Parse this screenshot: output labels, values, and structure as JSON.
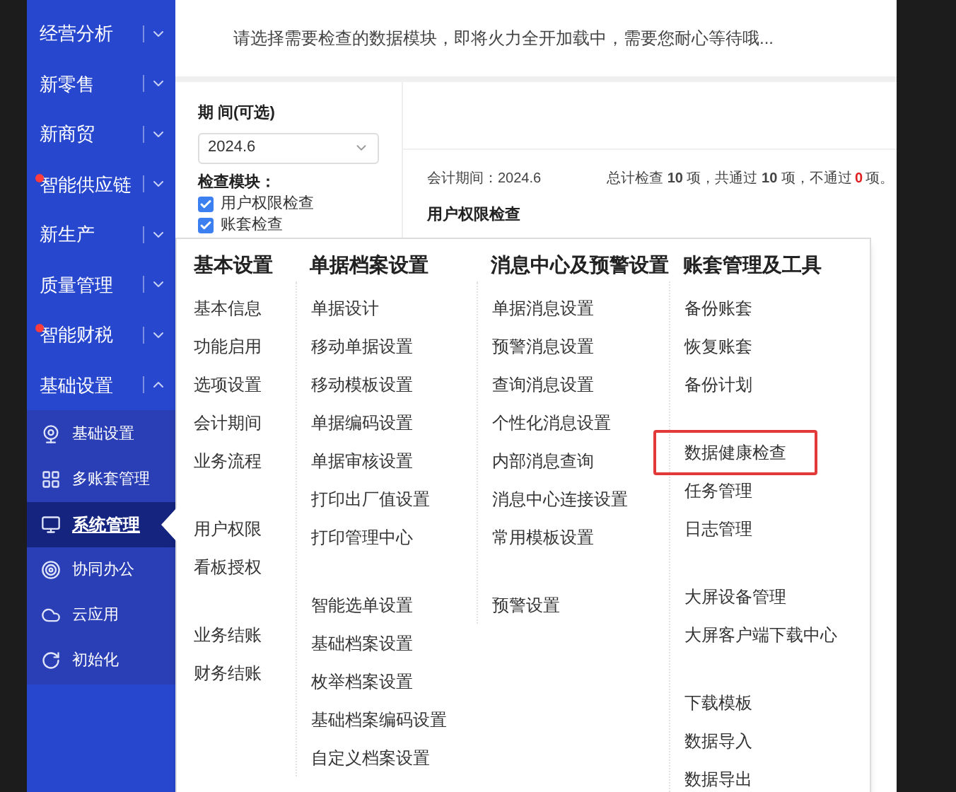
{
  "sidebar": {
    "items": [
      {
        "label": "经营分析",
        "expanded": false,
        "alert": false
      },
      {
        "label": "新零售",
        "expanded": false,
        "alert": false
      },
      {
        "label": "新商贸",
        "expanded": false,
        "alert": false
      },
      {
        "label": "智能供应链",
        "expanded": false,
        "alert": true
      },
      {
        "label": "新生产",
        "expanded": false,
        "alert": false
      },
      {
        "label": "质量管理",
        "expanded": false,
        "alert": false
      },
      {
        "label": "智能财税",
        "expanded": false,
        "alert": true
      },
      {
        "label": "基础设置",
        "expanded": true,
        "alert": false,
        "children": [
          {
            "label": "基础设置",
            "kind": "webcam",
            "selected": false
          },
          {
            "label": "多账套管理",
            "kind": "grid",
            "selected": false
          },
          {
            "label": "系统管理",
            "kind": "monitor",
            "selected": true
          },
          {
            "label": "协同办公",
            "kind": "target",
            "selected": false
          },
          {
            "label": "云应用",
            "kind": "cloud",
            "selected": false
          },
          {
            "label": "初始化",
            "kind": "refresh",
            "selected": false
          }
        ]
      }
    ]
  },
  "notice": "请选择需要检查的数据模块，即将火力全开加载中，需要您耐心等待哦...",
  "filter": {
    "period_label": "期 间(可选)",
    "period": "2024.6",
    "modules_label": "检查模块：",
    "modules": [
      {
        "label": "用户权限检查",
        "checked": true
      },
      {
        "label": "账套检查",
        "checked": true
      }
    ]
  },
  "result": {
    "period": "会计期间：2024.6",
    "summary": {
      "text": "总计检查 **10** 项，共通过 **10** 项，不通过",
      "failed": "0",
      "suffix": "项。"
    },
    "section_title": "用户权限检查"
  },
  "menu": {
    "columns": [
      {
        "title": "基本设置",
        "groups": [
          [
            {
              "label": "基本信息",
              "highlighted": false
            },
            {
              "label": "功能启用",
              "highlighted": false
            },
            {
              "label": "选项设置",
              "highlighted": false
            },
            {
              "label": "会计期间",
              "highlighted": false
            },
            {
              "label": "业务流程",
              "highlighted": false
            }
          ],
          [
            {
              "label": "用户权限",
              "highlighted": false
            },
            {
              "label": "看板授权",
              "highlighted": false
            }
          ],
          [
            {
              "label": "业务结账",
              "highlighted": false
            },
            {
              "label": "财务结账",
              "highlighted": false
            }
          ]
        ]
      },
      {
        "title": "单据档案设置",
        "groups": [
          [
            {
              "label": "单据设计",
              "highlighted": false
            },
            {
              "label": "移动单据设置",
              "highlighted": false
            },
            {
              "label": "移动模板设置",
              "highlighted": false
            },
            {
              "label": "单据编码设置",
              "highlighted": false
            },
            {
              "label": "单据审核设置",
              "highlighted": false
            },
            {
              "label": "打印出厂值设置",
              "highlighted": false
            },
            {
              "label": "打印管理中心",
              "highlighted": false
            }
          ],
          [
            {
              "label": "智能选单设置",
              "highlighted": false
            },
            {
              "label": "基础档案设置",
              "highlighted": false
            },
            {
              "label": "枚举档案设置",
              "highlighted": false
            },
            {
              "label": "基础档案编码设置",
              "highlighted": false
            },
            {
              "label": "自定义档案设置",
              "highlighted": false
            }
          ]
        ]
      },
      {
        "title": "消息中心及预警设置",
        "groups": [
          [
            {
              "label": "单据消息设置",
              "highlighted": false
            },
            {
              "label": "预警消息设置",
              "highlighted": false
            },
            {
              "label": "查询消息设置",
              "highlighted": false
            },
            {
              "label": "个性化消息设置",
              "highlighted": false
            },
            {
              "label": "内部消息查询",
              "highlighted": false
            },
            {
              "label": "消息中心连接设置",
              "highlighted": false
            },
            {
              "label": "常用模板设置",
              "highlighted": false
            }
          ],
          [
            {
              "label": "预警设置",
              "highlighted": false
            }
          ]
        ]
      },
      {
        "title": "账套管理及工具",
        "groups": [
          [
            {
              "label": "备份账套",
              "highlighted": false
            },
            {
              "label": "恢复账套",
              "highlighted": false
            },
            {
              "label": "备份计划",
              "highlighted": false
            }
          ],
          [
            {
              "label": "数据健康检查",
              "highlighted": true
            },
            {
              "label": "任务管理",
              "highlighted": false
            },
            {
              "label": "日志管理",
              "highlighted": false
            }
          ],
          [
            {
              "label": "大屏设备管理",
              "highlighted": false
            },
            {
              "label": "大屏客户端下载中心",
              "highlighted": false
            }
          ],
          [
            {
              "label": "下载模板",
              "highlighted": false
            },
            {
              "label": "数据导入",
              "highlighted": false
            },
            {
              "label": "数据导出",
              "highlighted": false
            }
          ]
        ]
      }
    ]
  }
}
